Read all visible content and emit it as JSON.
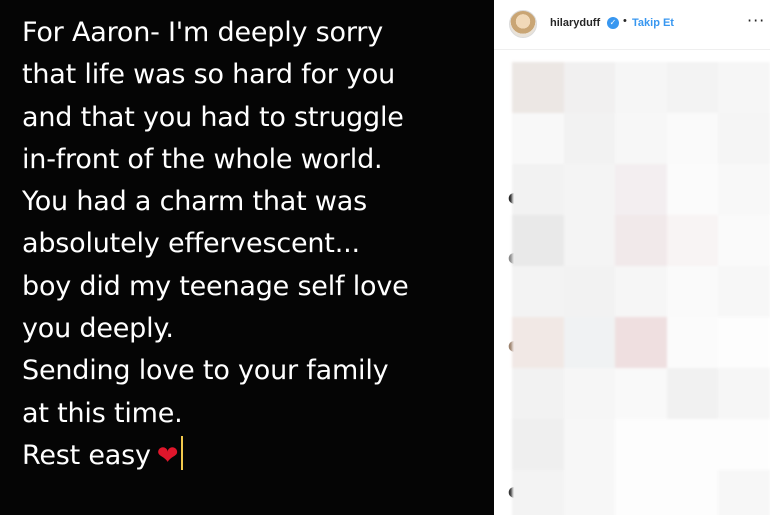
{
  "story": {
    "lines": [
      "For Aaron- I'm deeply sorry",
      "that life was so hard for you",
      "and that you had to struggle",
      "in-front of the whole world.",
      "You had a charm that was",
      "absolutely effervescent...",
      "boy did my teenage self love",
      "you deeply.",
      "Sending love to your family",
      "at this time.",
      "Rest easy"
    ],
    "emoji": "❤",
    "background": "#050505",
    "text_color": "#ffffff",
    "heart_color": "#e0162b",
    "caret_color": "#f2c94c"
  },
  "post": {
    "username": "hilaryduff",
    "verified_icon": "verified-badge-icon",
    "verified_glyph": "✓",
    "separator": "•",
    "follow_label": "Takip Et",
    "more_glyph": "···",
    "accent_color": "#3897f0"
  },
  "mosaic": {
    "tiles": [
      "#ece7e4",
      "#f1f0f0",
      "#f6f6f6",
      "#f3f3f3",
      "#f6f6f6",
      "#f8f8f8",
      "#f2f2f2",
      "#f7f7f7",
      "#fafafa",
      "#f5f5f5",
      "#f2f2f2",
      "#f4f4f4",
      "#f3eef0",
      "#fbfbfb",
      "#f8f8f8",
      "#e9e9e9",
      "#f4f4f4",
      "#f1e9ea",
      "#f8f4f4",
      "#fafafa",
      "#f3f3f3",
      "#f2f2f2",
      "#f6f6f6",
      "#fafafa",
      "#f7f7f7",
      "#f1e8e5",
      "#f0f2f3",
      "#efdfe0",
      "#fbfbfb",
      "#fdfdfd",
      "#f2f2f2",
      "#f6f6f6",
      "#f9f9f9",
      "#f1f1f1",
      "#f6f6f6",
      "#efefef",
      "#f7f7f7",
      "#fdfdfd",
      "#fdfdfd",
      "#fdfdfd",
      "#f3f3f3",
      "#f7f7f7",
      "#fdfdfd",
      "#fdfdfd",
      "#f7f7f7"
    ]
  }
}
